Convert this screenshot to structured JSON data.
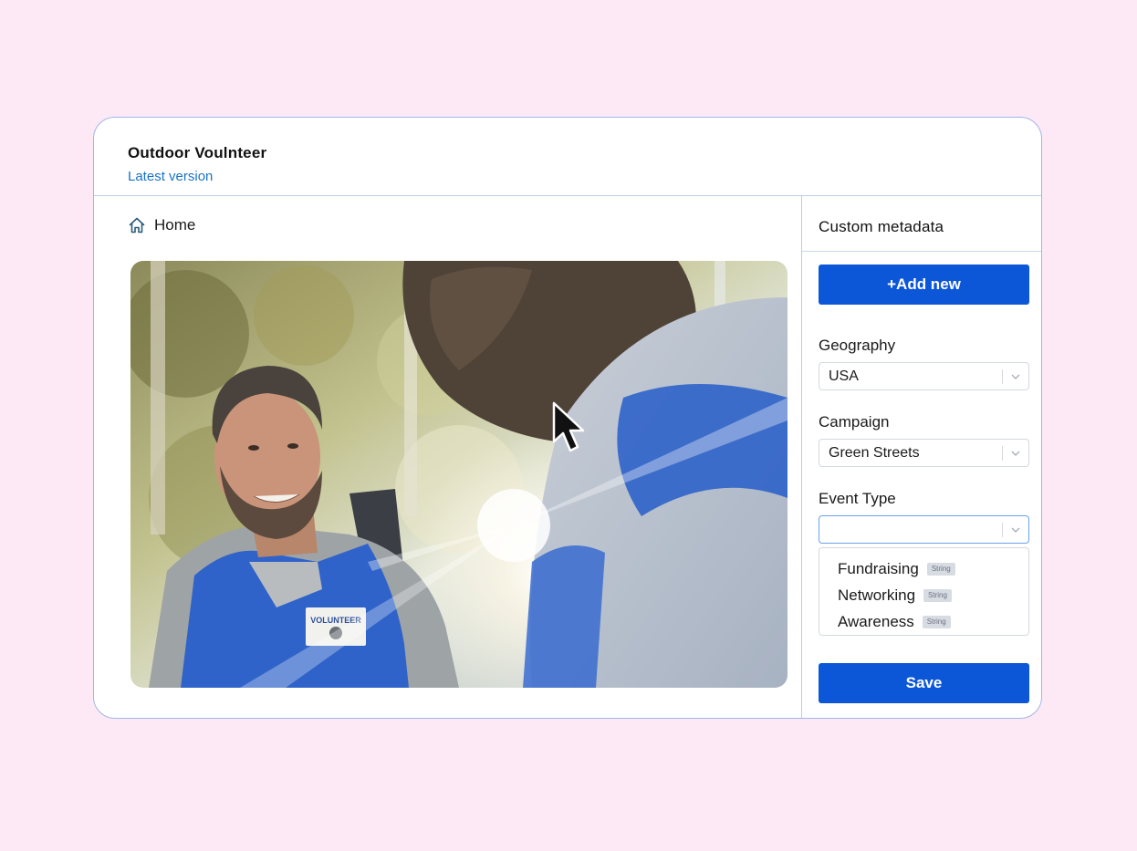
{
  "card": {
    "title": "Outdoor Voulnteer",
    "subtitle": "Latest version"
  },
  "breadcrumb": {
    "icon": "home-icon",
    "label": "Home"
  },
  "preview": {
    "badge_text": "VOLUNTEER"
  },
  "sidebar": {
    "title": "Custom metadata",
    "add_button_label": "+Add new",
    "save_button_label": "Save",
    "fields": [
      {
        "label": "Geography",
        "value": "USA"
      },
      {
        "label": "Campaign",
        "value": "Green Streets"
      },
      {
        "label": "Event Type",
        "value": ""
      }
    ],
    "dropdown_options": [
      {
        "label": "Fundraising",
        "type": "String"
      },
      {
        "label": "Networking",
        "type": "String"
      },
      {
        "label": "Awareness",
        "type": "String"
      }
    ]
  },
  "colors": {
    "page_background": "#fde9f6",
    "primary_button": "#0b57d8",
    "link_text": "#1a73c8",
    "border": "#b9cde8"
  }
}
